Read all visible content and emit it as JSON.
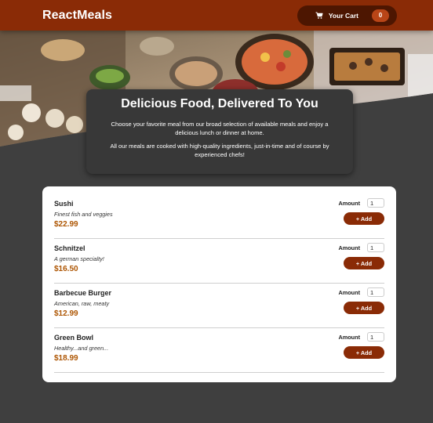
{
  "header": {
    "logo": "ReactMeals",
    "cart": {
      "label": "Your Cart",
      "count": "0"
    }
  },
  "summary": {
    "title": "Delicious Food, Delivered To You",
    "paragraph1": "Choose your favorite meal from our broad selection of available meals and enjoy a delicious lunch or dinner at home.",
    "paragraph2": "All our meals are cooked with high-quality ingredients, just-in-time and of course by experienced chefs!"
  },
  "meals": [
    {
      "name": "Sushi",
      "description": "Finest fish and veggies",
      "price": "$22.99",
      "amount_label": "Amount",
      "amount": "1",
      "add_label": "+ Add"
    },
    {
      "name": "Schnitzel",
      "description": "A german specialty!",
      "price": "$16.50",
      "amount_label": "Amount",
      "amount": "1",
      "add_label": "+ Add"
    },
    {
      "name": "Barbecue Burger",
      "description": "American, raw, meaty",
      "price": "$12.99",
      "amount_label": "Amount",
      "amount": "1",
      "add_label": "+ Add"
    },
    {
      "name": "Green Bowl",
      "description": "Healthy...and green...",
      "price": "$18.99",
      "amount_label": "Amount",
      "amount": "1",
      "add_label": "+ Add"
    }
  ],
  "colors": {
    "header": "#8a2b06",
    "cart_button": "#4d1601",
    "badge": "#b94517",
    "price": "#ad5502",
    "background": "#3f3f3f"
  },
  "icons": {
    "cart": "cart-icon"
  }
}
